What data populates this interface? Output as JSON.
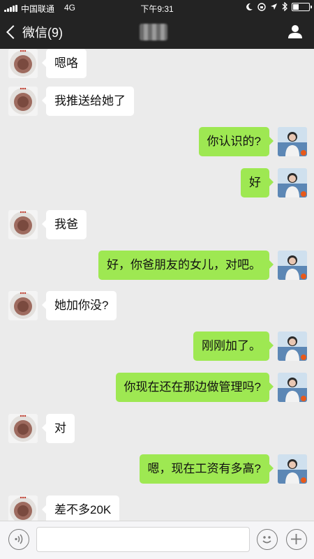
{
  "status_bar": {
    "carrier": "中国联通",
    "network": "4G",
    "time": "下午9:31",
    "battery_level": 0.35
  },
  "nav": {
    "back_label": "微信(9)",
    "icons": {
      "back": "chevron-left-icon",
      "profile": "person-icon"
    }
  },
  "messages": [
    {
      "side": "recv",
      "text": "嗯咯"
    },
    {
      "side": "recv",
      "text": "我推送给她了"
    },
    {
      "side": "sent",
      "text": "你认识的?"
    },
    {
      "side": "sent",
      "text": "好"
    },
    {
      "side": "recv",
      "text": "我爸"
    },
    {
      "side": "sent",
      "text": "好，你爸朋友的女儿，对吧。"
    },
    {
      "side": "recv",
      "text": "她加你没?"
    },
    {
      "side": "sent",
      "text": "刚刚加了。"
    },
    {
      "side": "sent",
      "text": "你现在还在那边做管理吗?"
    },
    {
      "side": "recv",
      "text": "对"
    },
    {
      "side": "sent",
      "text": "嗯，现在工资有多高?"
    },
    {
      "side": "recv",
      "text": "差不多20K"
    }
  ],
  "input_bar": {
    "icons": {
      "voice": "voice-icon",
      "emoji": "emoji-icon",
      "more": "plus-icon"
    },
    "value": ""
  },
  "colors": {
    "sent_bubble": "#9ee852",
    "recv_bubble": "#ffffff",
    "bar": "#232323",
    "background": "#ebebeb"
  }
}
